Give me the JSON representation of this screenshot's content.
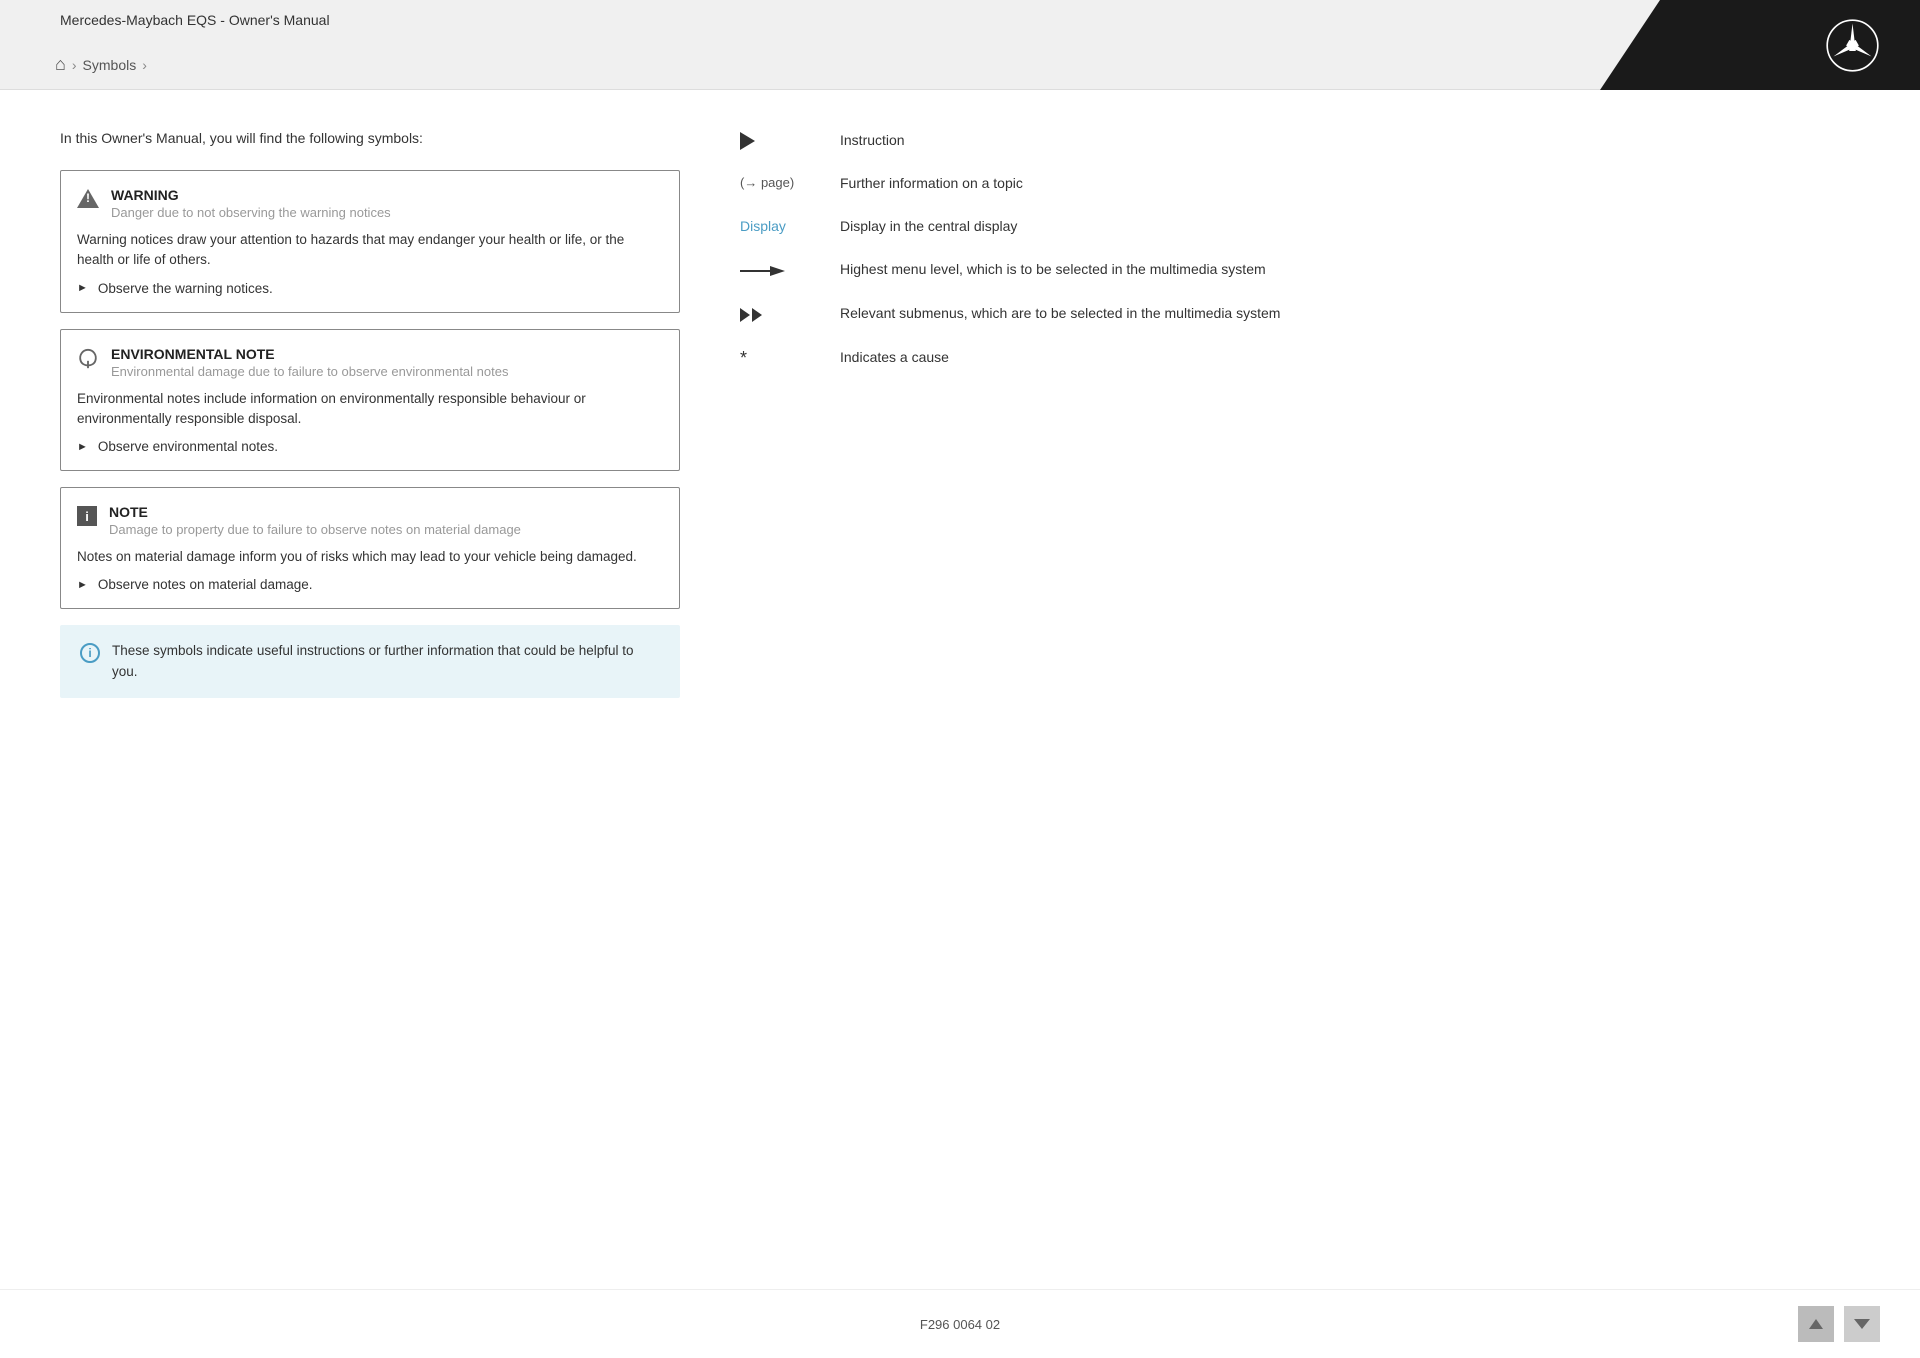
{
  "header": {
    "title": "Mercedes-Maybach EQS - Owner's Manual",
    "breadcrumb": {
      "home_label": "⌂",
      "sep": ">",
      "current": "Symbols",
      "sep2": ">"
    }
  },
  "intro": {
    "text": "In this Owner's Manual, you will find the following symbols:"
  },
  "notices": [
    {
      "id": "warning",
      "title": "WARNING",
      "subtitle": "Danger due to not observing the warning notices",
      "body": "Warning notices draw your attention to hazards that may endanger your health or life, or the health or life of others.",
      "instruction": "Observe the warning notices."
    },
    {
      "id": "environmental",
      "title": "ENVIRONMENTAL NOTE",
      "subtitle": "Environmental damage due to failure to observe environmental notes",
      "body": "Environmental notes include information on environmentally responsible behaviour or environmentally responsible disposal.",
      "instruction": "Observe environmental notes."
    },
    {
      "id": "note",
      "title": "NOTE",
      "subtitle": "Damage to property due to failure to observe notes on material damage",
      "body": "Notes on material damage inform you of risks which may lead to your vehicle being damaged.",
      "instruction": "Observe notes on material damage."
    }
  ],
  "info_box": {
    "text": "These symbols indicate useful instructions or further information that could be helpful to you."
  },
  "symbols": [
    {
      "icon_type": "play",
      "description": "Instruction"
    },
    {
      "icon_type": "arrow_text",
      "icon_text": "(→ page)",
      "description": "Further information on a topic"
    },
    {
      "icon_type": "display_text",
      "icon_text": "Display",
      "description": "Display in the central display"
    },
    {
      "icon_type": "menu_arrow",
      "description": "Highest menu level, which is to be selected in the multimedia system"
    },
    {
      "icon_type": "double_arrow",
      "description": "Relevant submenus, which are to be selected in the multimedia system"
    },
    {
      "icon_type": "asterisk",
      "icon_text": "*",
      "description": "Indicates a cause"
    }
  ],
  "footer": {
    "code": "F296 0064 02"
  }
}
